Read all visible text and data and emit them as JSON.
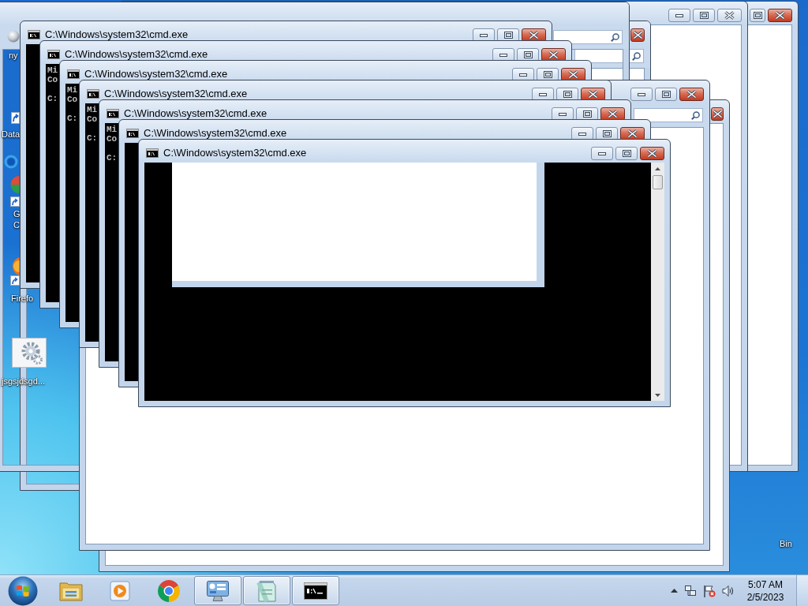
{
  "desktop_icons": [
    {
      "kind": "sphere",
      "label": [
        "ny"
      ]
    },
    {
      "kind": "shortcut",
      "label": [
        "Data"
      ]
    },
    {
      "kind": "ring"
    },
    {
      "kind": "chrome",
      "label": [
        "G",
        "C"
      ]
    },
    {
      "kind": "firefox",
      "label": [
        "Firefo"
      ]
    },
    {
      "kind": "gear",
      "label": [
        "jsgsjdsgd..."
      ]
    },
    {
      "label": [
        "Bin"
      ]
    }
  ],
  "background_windows": [
    {
      "kind": "plain",
      "painted": true,
      "active": true,
      "buttons": [
        {
          "kind": "maximize"
        },
        {
          "kind": "close"
        }
      ]
    },
    {
      "kind": "plain",
      "painted": true,
      "active": false,
      "buttons": [
        {
          "kind": "minimize"
        },
        {
          "kind": "maximize"
        },
        {
          "kind": "close"
        }
      ]
    },
    {
      "kind": "explorer",
      "painted": false,
      "active": true,
      "buttons": [
        {
          "kind": "close"
        }
      ]
    },
    {
      "kind": "explorer",
      "painted": false
    },
    {
      "kind": "plain",
      "painted": true,
      "active": true,
      "buttons": [
        {
          "kind": "close"
        }
      ]
    },
    {
      "kind": "explorer",
      "painted": true,
      "active": true,
      "buttons": [
        {
          "kind": "minimize"
        },
        {
          "kind": "maximize"
        },
        {
          "kind": "close"
        }
      ]
    }
  ],
  "cmd_windows": [
    {
      "title": "C:\\Windows\\system32\\cmd.exe",
      "active": true
    },
    {
      "title": "C:\\Windows\\system32\\cmd.exe",
      "active": true,
      "banner": [
        "Mi",
        "Co"
      ],
      "prompt": "C:"
    },
    {
      "title": "C:\\Windows\\system32\\cmd.exe",
      "active": true,
      "banner": [
        "Mi",
        "Co"
      ],
      "prompt": "C:"
    },
    {
      "title": "C:\\Windows\\system32\\cmd.exe",
      "active": true,
      "banner": [
        "Mi",
        "Co"
      ],
      "prompt": "C:"
    },
    {
      "title": "C:\\Windows\\system32\\cmd.exe",
      "active": true,
      "banner": [
        "Mi",
        "Co"
      ],
      "prompt": "C:"
    },
    {
      "title": "C:\\Windows\\system32\\cmd.exe",
      "active": true
    },
    {
      "title": "C:\\Windows\\system32\\cmd.exe",
      "active": true,
      "console_blank": true
    }
  ],
  "taskbar": {
    "items": [
      {
        "kind": "explorer",
        "running": false
      },
      {
        "kind": "media",
        "running": false
      },
      {
        "kind": "chrome",
        "running": false
      },
      {
        "kind": "control-panel",
        "running": true
      },
      {
        "kind": "notepad",
        "running": true
      },
      {
        "kind": "console",
        "running": true
      }
    ],
    "clock": {
      "time": "5:07 AM",
      "date": "2/5/2023"
    }
  }
}
